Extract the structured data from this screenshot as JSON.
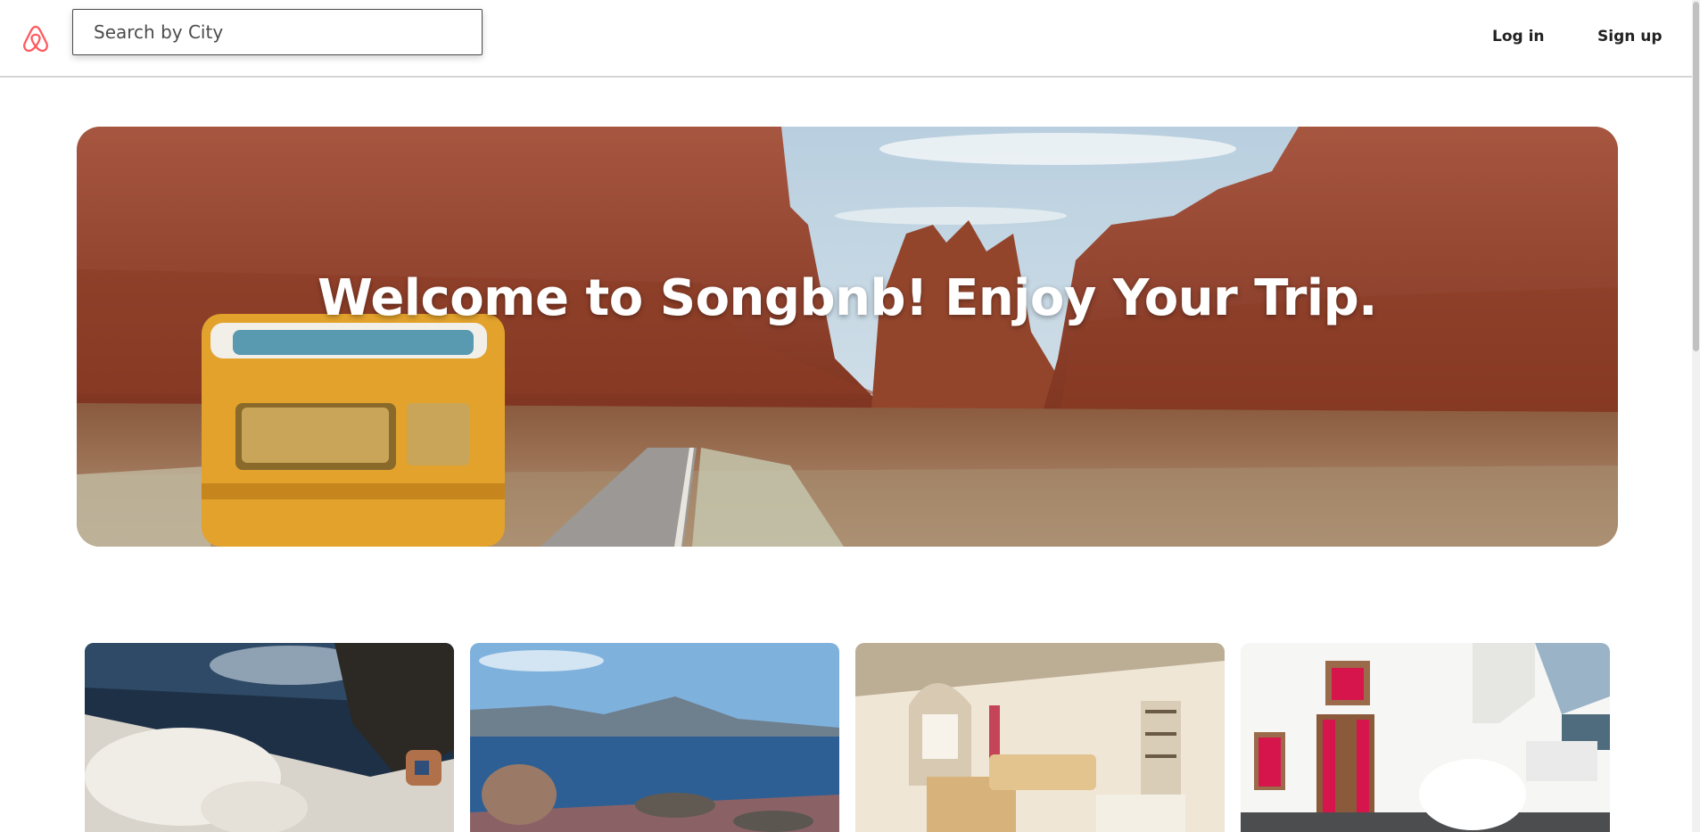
{
  "search": {
    "placeholder": "Search by City"
  },
  "nav": {
    "login_label": "Log in",
    "signup_label": "Sign up"
  },
  "hero": {
    "title": "Welcome to Songbnb! Enjoy Your Trip."
  },
  "listings": [
    {
      "name": "listing-card-1"
    },
    {
      "name": "listing-card-2"
    },
    {
      "name": "listing-card-3"
    },
    {
      "name": "listing-card-4"
    }
  ],
  "colors": {
    "brand": "#ff5a5f",
    "rock": "#9e4a33",
    "sky": "#bcd3e3",
    "van": "#e2a22c"
  },
  "icons": {
    "logo": "airbnb-logo-icon"
  }
}
